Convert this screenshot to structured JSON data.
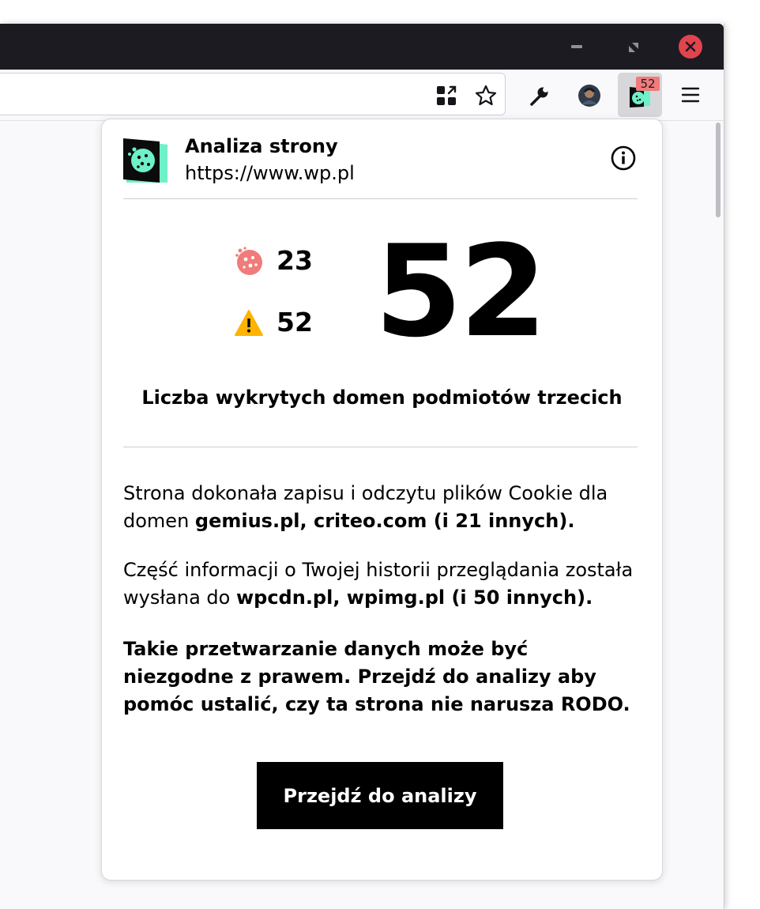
{
  "browser": {
    "extension_badge": "52"
  },
  "popup": {
    "header": {
      "title": "Analiza strony",
      "url": "https://www.wp.pl"
    },
    "stats": {
      "cookie_count": "23",
      "warning_count": "52",
      "main_count": "52",
      "caption": "Liczba wykrytych domen podmiotów trzecich"
    },
    "cookies_para": {
      "text": "Strona dokonała zapisu i odczytu plików Cookie dla domen ",
      "domains": "gemius.pl, criteo.com (i 21 innych)."
    },
    "history_para": {
      "text": "Część informacji o Twojej historii przeglądania została wysłana do ",
      "domains": "wpcdn.pl, wpimg.pl (i 50 innych)."
    },
    "warning_text": "Takie przetwarzanie danych może być niezgodne z prawem. Przejdź do analizy aby pomóc ustalić, czy ta strona nie narusza RODO.",
    "cta_label": "Przejdź do analizy"
  },
  "colors": {
    "titlebar": "#1c1b22",
    "close_button": "#e2444e",
    "badge": "#f07b7b",
    "logo_mint": "#6ef0c8",
    "cookie_icon": "#f07b7b",
    "warning_icon": "#ffb300",
    "cta_background": "#000000"
  },
  "icons": [
    "minimize-icon",
    "restore-icon",
    "close-icon",
    "extensions-grid-icon",
    "bookmark-star-icon",
    "wrench-icon",
    "profile-avatar",
    "cookie-extension-icon",
    "menu-icon",
    "info-icon",
    "cookie-icon",
    "warning-icon"
  ]
}
